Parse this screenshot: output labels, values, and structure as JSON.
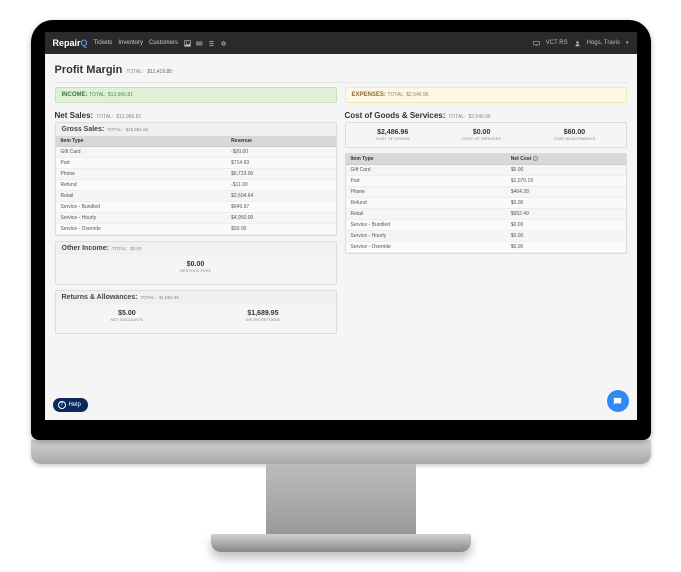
{
  "header": {
    "logo_main": "Repair",
    "logo_accent": "Q",
    "nav": [
      "Tickets",
      "Inventory",
      "Customers"
    ],
    "store": "VCT RS",
    "user": "Hogs, Travis",
    "user_icon": "user-icon",
    "monitor_icon": "monitor-icon",
    "dropdown_icon": "chevron-down-icon"
  },
  "page": {
    "title": "Profit Margin",
    "total_label": "TOTAL:",
    "total_value": "$11,419.85"
  },
  "income": {
    "banner_label": "INCOME:",
    "banner_total_label": "TOTAL:",
    "banner_total_value": "$13,966.81",
    "net_sales": {
      "title": "Net Sales:",
      "total_label": "TOTAL:",
      "total_value": "$13,966.81"
    },
    "gross_sales": {
      "title": "Gross Sales:",
      "total_label": "TOTAL:",
      "total_value": "$15,661.55",
      "cols": [
        "Item Type",
        "Revenue"
      ],
      "rows": [
        [
          "Gift Card",
          "-$20.00"
        ],
        [
          "Part",
          "$714.93"
        ],
        [
          "Phone",
          "$6,723.00"
        ],
        [
          "Refund",
          "-$11.00"
        ],
        [
          "Retail",
          "$2,604.64"
        ],
        [
          "Service - Bundled",
          "$649.97"
        ],
        [
          "Service - Hourly",
          "$4,950.00"
        ],
        [
          "Service - Override",
          "$50.00"
        ]
      ]
    },
    "other_income": {
      "title": "Other Income:",
      "total_label": "TOTAL:",
      "total_value": "$0.00",
      "stats": [
        {
          "value": "$0.00",
          "label": "RESTOCK FEES"
        }
      ]
    },
    "returns": {
      "title": "Returns & Allowances:",
      "total_label": "TOTAL:",
      "total_value": "$1,694.95",
      "stats": [
        {
          "value": "$5.00",
          "label": "NET DISCOUNTS"
        },
        {
          "value": "$1,689.95",
          "label": "GROSS RETURNS"
        }
      ]
    }
  },
  "expenses": {
    "banner_label": "EXPENSES:",
    "banner_total_label": "TOTAL:",
    "banner_total_value": "$2,546.96",
    "cogs": {
      "title": "Cost of Goods & Services:",
      "total_label": "TOTAL:",
      "total_value": "$2,546.96",
      "stats": [
        {
          "value": "$2,486.96",
          "label": "COST OF GOODS"
        },
        {
          "value": "$0.00",
          "label": "COST OF SERVICES"
        },
        {
          "value": "$60.00",
          "label": "COST ADJUSTMENTS"
        }
      ],
      "cols": [
        "Item Type",
        "Net Cost"
      ],
      "info_icon": "info-icon",
      "rows": [
        [
          "Gift Card",
          "$0.00"
        ],
        [
          "Part",
          "$1,070.19"
        ],
        [
          "Phone",
          "$464.28"
        ],
        [
          "Refund",
          "$0.00"
        ],
        [
          "Retail",
          "$952.49"
        ],
        [
          "Service - Bundled",
          "$0.00"
        ],
        [
          "Service - Hourly",
          "$0.00"
        ],
        [
          "Service - Override",
          "$0.00"
        ]
      ]
    }
  },
  "help_label": "Help",
  "chat_icon": "chat-icon"
}
